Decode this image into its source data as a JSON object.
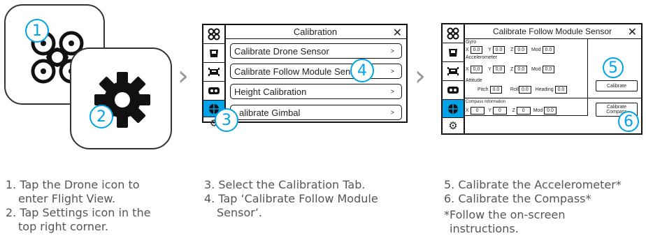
{
  "steps": {
    "col1": [
      "1. Tap the Drone icon to",
      "enter Flight View.",
      "2. Tap Settings icon in the",
      "top right corner."
    ],
    "col2": [
      "3. Select the Calibration Tab.",
      "4. Tap ‘Calibrate Follow Module",
      "Sensor’."
    ],
    "col3": [
      "5. Calibrate the Accelerometer*",
      "6. Calibrate the Compass*"
    ],
    "note": [
      "*Follow  the  on-screen",
      "instructions."
    ]
  },
  "callouts": [
    "1",
    "2",
    "3",
    "4",
    "5",
    "6"
  ],
  "panel1": {
    "title": "Calibration",
    "close": "✕",
    "items": [
      "Calibrate Drone Sensor",
      "Calibrate Follow Module Sensor",
      "Height Calibration",
      "alibrate Gimbal"
    ],
    "arrow": ">"
  },
  "panel2": {
    "title": "Calibrate Follow Module Sensor",
    "close": "✕",
    "gyro": "Gyro",
    "accel": "Accelerometer",
    "attitude": "Attitude",
    "x": "X",
    "y": "Y",
    "z": "Z",
    "mod": "Mod",
    "pitch": "Pitch",
    "roll": "Roll",
    "heading": "Heading",
    "val": "0.0",
    "val0": "0",
    "compass_info": "Compass Information",
    "calibrate": "Calibrate",
    "calibrate_compass_1": "Calibrate",
    "calibrate_compass_2": "Compass"
  },
  "colors": {
    "accent": "#00a3e8",
    "ink": "#111111",
    "text": "#555555"
  }
}
